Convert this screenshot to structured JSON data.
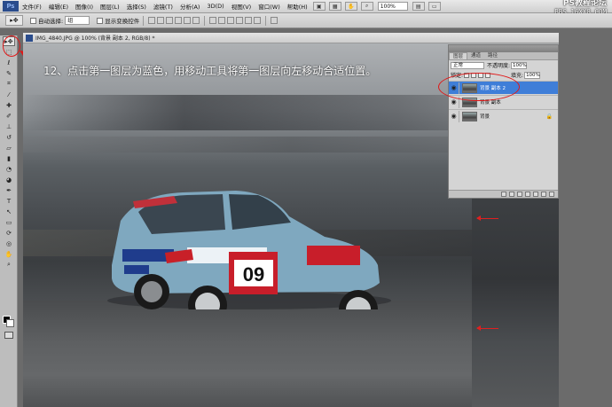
{
  "app": {
    "logo": "Ps",
    "menu": [
      "文件(F)",
      "编辑(E)",
      "图像(I)",
      "图层(L)",
      "选择(S)",
      "滤镜(T)",
      "分析(A)",
      "3D(D)",
      "视图(V)",
      "窗口(W)",
      "帮助(H)"
    ],
    "zoom": "100%",
    "watermark_line1": "PS教程论坛",
    "watermark_line2": "BBS.16XX8.COM"
  },
  "options_bar": {
    "auto_select_label": "自动选择:",
    "auto_select_value": "组",
    "show_transform_label": "显示变换控件"
  },
  "document": {
    "tab_title": "IMG_4840.JPG @ 100% (背景 副本 2, RGB/8) *",
    "instruction": "12、点击第一图层为蓝色，用移动工具将第一图层向左移动合适位置。"
  },
  "car": {
    "number": "09"
  },
  "layers_panel": {
    "tabs": [
      "图层",
      "通道",
      "路径"
    ],
    "blend_mode": "正常",
    "opacity_label": "不透明度:",
    "opacity_value": "100%",
    "lock_label": "锁定:",
    "fill_label": "填充:",
    "fill_value": "100%",
    "layers": [
      {
        "name": "背景 副本 2",
        "selected": true,
        "locked": false
      },
      {
        "name": "背景 副本",
        "selected": false,
        "locked": false
      },
      {
        "name": "背景",
        "selected": false,
        "locked": true
      }
    ],
    "lock_glyph": "🔒"
  },
  "colors": {
    "selection_blue": "#3f7ed8",
    "annotation_red": "#e01818"
  }
}
